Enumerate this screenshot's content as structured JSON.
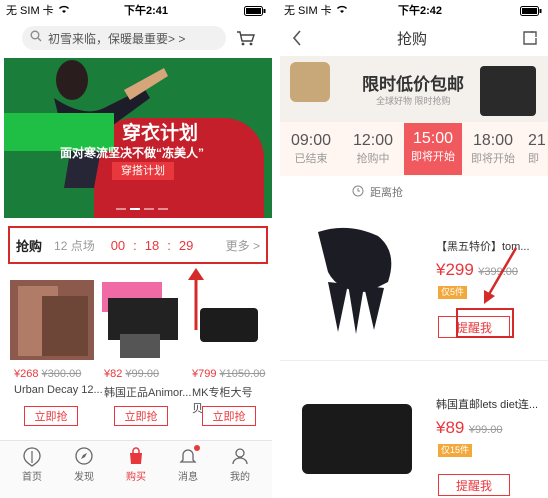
{
  "left": {
    "status": {
      "carrier": "无 SIM 卡",
      "time": "下午2:41"
    },
    "search": {
      "placeholder": "初雪来临，保暖最重要> >"
    },
    "banner": {
      "headline": "穿衣计划",
      "subline": "面对寒流坚决不做“冻美人”",
      "button": "穿搭计划"
    },
    "flash": {
      "title": "抢购",
      "session": "12 点场",
      "h": "00",
      "m": "18",
      "s": "29",
      "more": "更多"
    },
    "products": [
      {
        "price": "¥268",
        "old_price": "¥300.00",
        "name": "Urban Decay 12...",
        "button": "立即抢"
      },
      {
        "price": "¥82",
        "old_price": "¥99.00",
        "name": "韩国正品Animor...",
        "button": "立即抢"
      },
      {
        "price": "¥799",
        "old_price": "¥1050.00",
        "name": "MK专柜大号贝...",
        "button": "立即抢"
      }
    ],
    "tabbar": [
      {
        "label": "首页",
        "icon": "home-icon"
      },
      {
        "label": "发现",
        "icon": "compass-icon"
      },
      {
        "label": "购买",
        "icon": "bag-icon"
      },
      {
        "label": "消息",
        "icon": "bell-icon"
      },
      {
        "label": "我的",
        "icon": "person-icon"
      }
    ]
  },
  "right": {
    "status": {
      "carrier": "无 SIM 卡",
      "time": "下午2:42"
    },
    "nav": {
      "title": "抢购"
    },
    "banner": {
      "headline": "限时低价包邮",
      "subline": "全球好物 限时抢购"
    },
    "slots": [
      {
        "time": "09:00",
        "state": "已结束"
      },
      {
        "time": "12:00",
        "state": "抢购中"
      },
      {
        "time": "15:00",
        "state": "即将开始",
        "active": true
      },
      {
        "time": "18:00",
        "state": "即将开始"
      },
      {
        "time": "21",
        "state": "即"
      }
    ],
    "countdown": {
      "label": "距离抢"
    },
    "items": [
      {
        "name": "【黑五特价】tom...",
        "price": "¥299",
        "old_price": "¥399.00",
        "badge": "仅5件",
        "button": "提醒我"
      },
      {
        "name": "韩国直邮lets diet连...",
        "price": "¥89",
        "old_price": "¥99.00",
        "badge": "仅15件",
        "button": "提醒我"
      }
    ]
  },
  "colors": {
    "accent": "#e8383d",
    "annotation": "#d42a2a"
  }
}
